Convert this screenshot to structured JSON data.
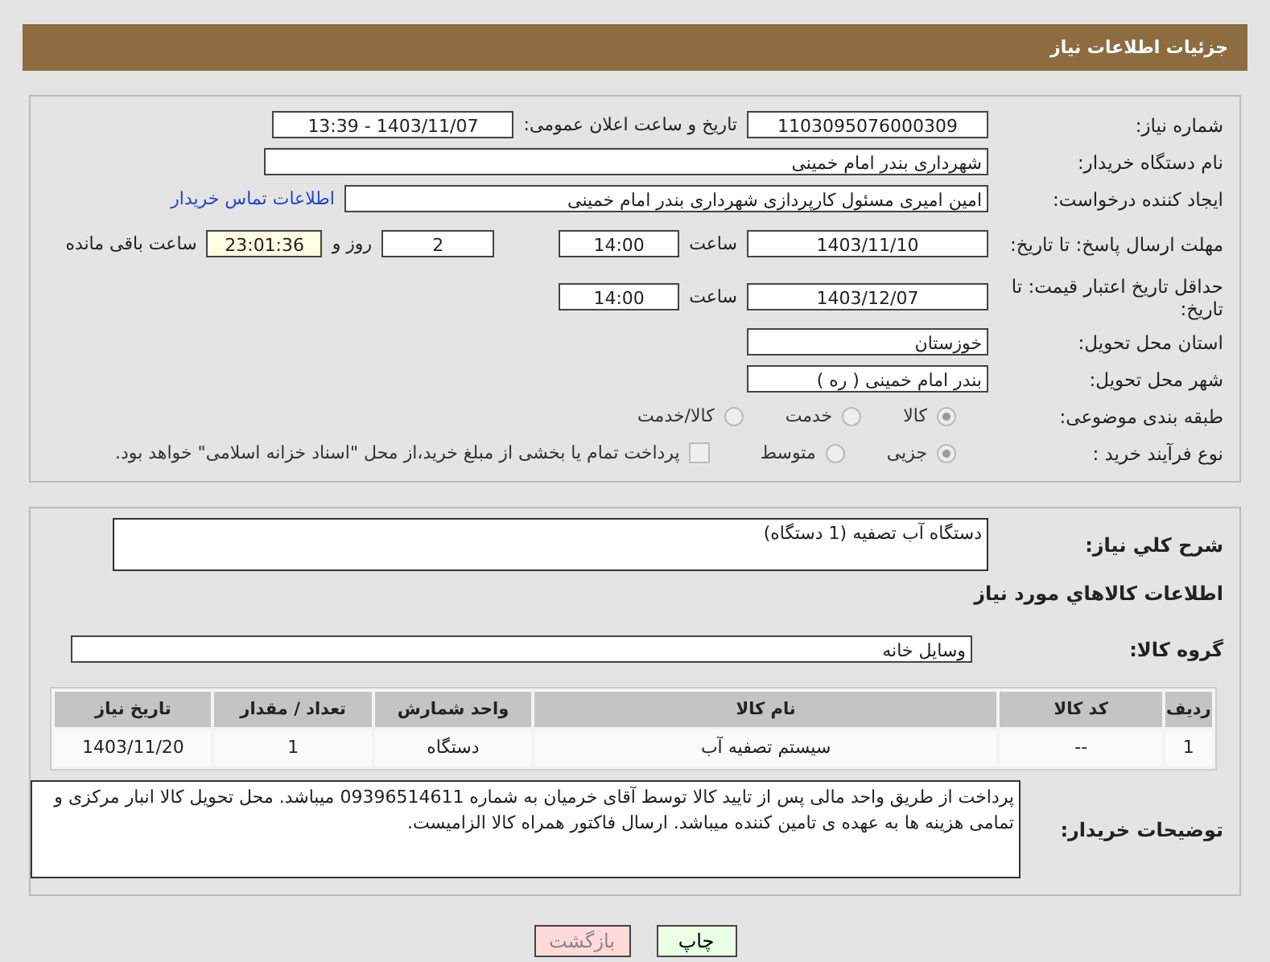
{
  "header": {
    "title": "جزئیات اطلاعات نیاز"
  },
  "need_number": {
    "label": "شماره نیاز:",
    "value": "1103095076000309"
  },
  "announce": {
    "label": "تاریخ و ساعت اعلان عمومی:",
    "value": "1403/11/07 - 13:39"
  },
  "buyer": {
    "label": "نام دستگاه خریدار:",
    "value": "شهرداری بندر امام خمینی"
  },
  "creator": {
    "label": "ایجاد کننده درخواست:",
    "value": "امین امیری مسئول کارپردازی شهرداری بندر امام خمینی",
    "link": "اطلاعات تماس خریدار"
  },
  "deadline": {
    "label": "مهلت ارسال پاسخ: تا تاریخ:",
    "date": "1403/11/10",
    "time_label": "ساعت",
    "time": "14:00",
    "days": "2",
    "days_label": "روز و",
    "remaining": "23:01:36",
    "remaining_label": "ساعت باقی مانده"
  },
  "validity": {
    "label": "حداقل تاریخ اعتبار قیمت: تا تاریخ:",
    "date": "1403/12/07",
    "time_label": "ساعت",
    "time": "14:00"
  },
  "province": {
    "label": "استان محل تحویل:",
    "value": "خوزستان"
  },
  "city": {
    "label": "شهر محل تحویل:",
    "value": "بندر امام خمینی ( ره )"
  },
  "category": {
    "label": "طبقه بندی موضوعی:",
    "options": [
      {
        "label": "کالا",
        "selected": true
      },
      {
        "label": "خدمت",
        "selected": false
      },
      {
        "label": "کالا/خدمت",
        "selected": false
      }
    ]
  },
  "process": {
    "label": "نوع فرآیند خرید :",
    "options": [
      {
        "label": "جزیی",
        "selected": true
      },
      {
        "label": "متوسط",
        "selected": false
      }
    ],
    "treasury": {
      "label": "پرداخت تمام یا بخشی از مبلغ خرید،از محل \"اسناد خزانه اسلامی\" خواهد بود.",
      "checked": false
    }
  },
  "description": {
    "label": "شرح کلي نیاز:",
    "value": "دستگاه آب تصفیه (1 دستگاه)"
  },
  "goods_heading": "اطلاعات کالاهاي مورد نیاز",
  "goods_group": {
    "label": "گروه کالا:",
    "value": "وسایل خانه"
  },
  "table": {
    "columns": [
      "ردیف",
      "کد کالا",
      "نام کالا",
      "واحد شمارش",
      "تعداد / مقدار",
      "تاریخ نیاز"
    ],
    "rows": [
      [
        "1",
        "--",
        "سیستم تصفیه آب",
        "دستگاه",
        "1",
        "1403/11/20"
      ]
    ]
  },
  "notes": {
    "label": "توضیحات خریدار:",
    "value": "پرداخت از طریق واحد مالی پس از تایید کالا توسط آقای خرمیان به شماره 09396514611 میباشد. محل تحویل کالا انبار مرکزی و تمامی هزینه ها به عهده ی تامین کننده میباشد. ارسال فاکتور همراه کالا الزامیست."
  },
  "buttons": [
    {
      "label": "چاپ",
      "kind": "print"
    },
    {
      "label": "بازگشت",
      "kind": "back"
    }
  ]
}
